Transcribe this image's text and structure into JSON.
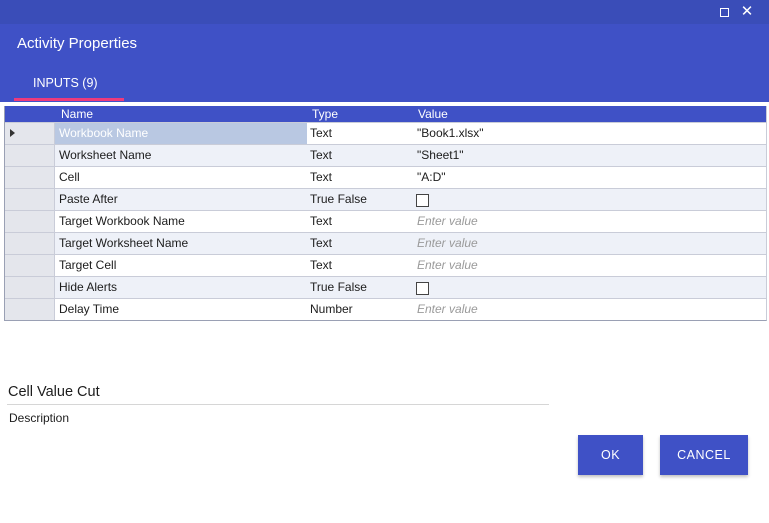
{
  "window": {
    "maximize_icon": "maximize-icon",
    "close_glyph": "✕"
  },
  "dialog": {
    "title": "Activity Properties",
    "tab_label": "INPUTS (9)"
  },
  "grid": {
    "columns": {
      "name": "Name",
      "type": "Type",
      "value": "Value"
    },
    "rows": [
      {
        "name": "Workbook Name",
        "type": "Text",
        "value": "\"Book1.xlsx\"",
        "kind": "text"
      },
      {
        "name": "Worksheet Name",
        "type": "Text",
        "value": "\"Sheet1\"",
        "kind": "text"
      },
      {
        "name": "Cell",
        "type": "Text",
        "value": "\"A:D\"",
        "kind": "text"
      },
      {
        "name": "Paste After",
        "type": "True False",
        "value": "",
        "kind": "checkbox",
        "checked": false
      },
      {
        "name": "Target Workbook Name",
        "type": "Text",
        "value": "Enter value",
        "kind": "placeholder"
      },
      {
        "name": "Target Worksheet Name",
        "type": "Text",
        "value": "Enter value",
        "kind": "placeholder"
      },
      {
        "name": "Target Cell",
        "type": "Text",
        "value": "Enter value",
        "kind": "placeholder"
      },
      {
        "name": "Hide Alerts",
        "type": "True False",
        "value": "",
        "kind": "checkbox",
        "checked": false
      },
      {
        "name": "Delay Time",
        "type": "Number",
        "value": "Enter value",
        "kind": "placeholder"
      }
    ]
  },
  "activity": {
    "name": "Cell Value Cut",
    "description": "Description"
  },
  "buttons": {
    "ok": "OK",
    "cancel": "CANCEL"
  },
  "colors": {
    "primary": "#3f51c6",
    "titlebar": "#3a4db8",
    "accent": "#ef3a7b",
    "selected": "#b9c8e2"
  }
}
